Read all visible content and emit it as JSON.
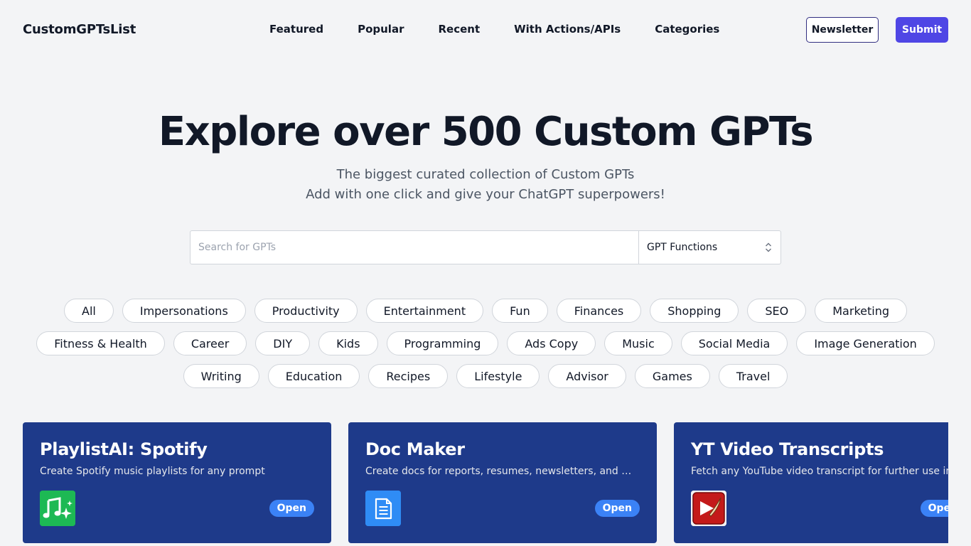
{
  "header": {
    "brand": "CustomGPTsList",
    "nav": [
      "Featured",
      "Popular",
      "Recent",
      "With Actions/APIs",
      "Categories"
    ],
    "newsletter_label": "Newsletter",
    "submit_label": "Submit"
  },
  "hero": {
    "title": "Explore over 500 Custom GPTs",
    "subtitle_line1": "The biggest curated collection of Custom GPTs",
    "subtitle_line2": "Add with one click and give your ChatGPT superpowers!"
  },
  "search": {
    "placeholder": "Search for GPTs",
    "value": "",
    "select_value": "GPT Functions"
  },
  "categories": {
    "row1": [
      "All",
      "Impersonations",
      "Productivity",
      "Entertainment",
      "Fun",
      "Finances",
      "Shopping",
      "SEO",
      "Marketing"
    ],
    "row2": [
      "Fitness & Health",
      "Career",
      "DIY",
      "Kids",
      "Programming",
      "Ads Copy",
      "Music",
      "Social Media",
      "Image Generation"
    ],
    "row3": [
      "Writing",
      "Education",
      "Recipes",
      "Lifestyle",
      "Advisor",
      "Games",
      "Travel"
    ]
  },
  "cards": [
    {
      "title": "PlaylistAI: Spotify",
      "description": "Create Spotify music playlists for any prompt",
      "icon": "music-sparkle-icon",
      "icon_bg": "#1db954",
      "open_label": "Open"
    },
    {
      "title": "Doc Maker",
      "description": "Create docs for reports, resumes, newsletters, and more....",
      "icon": "document-icon",
      "icon_bg": "#2f8cf5",
      "open_label": "Open"
    },
    {
      "title": "YT Video Transcripts",
      "description": "Fetch any YouTube video transcript for further use in su",
      "icon": "video-play-icon",
      "icon_bg": "#c41a1a",
      "open_label": "Open"
    }
  ],
  "colors": {
    "page_bg": "#f3f4f6",
    "card_bg": "#1e3a8a",
    "accent": "#4f46e5",
    "open_badge": "#3b82f6"
  }
}
